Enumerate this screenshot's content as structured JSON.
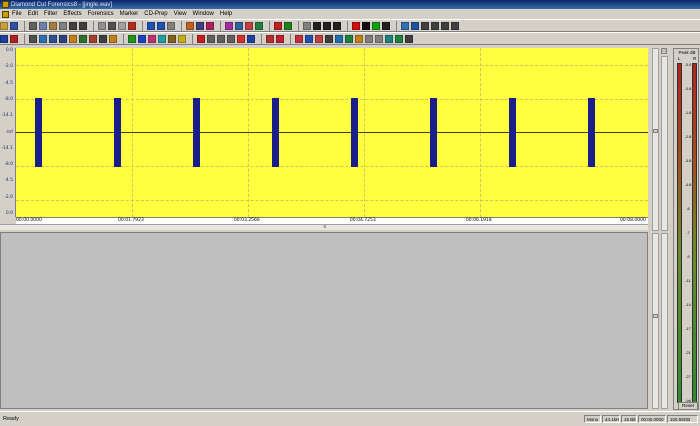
{
  "window": {
    "title": "Diamond Cut Forensics8 - [jingle.wav]"
  },
  "menu": [
    "File",
    "Edit",
    "Filter",
    "Effects",
    "Forensics",
    "Marker",
    "CD-Prep",
    "View",
    "Window",
    "Help"
  ],
  "toolbar_row1": [
    {
      "name": "open-icon",
      "color": "#c8a040"
    },
    {
      "name": "save-icon",
      "color": "#3050a0"
    },
    {
      "name": "sep"
    },
    {
      "name": "cut-icon",
      "color": "#606060"
    },
    {
      "name": "copy-icon",
      "color": "#7080b0"
    },
    {
      "name": "paste-icon",
      "color": "#a08040"
    },
    {
      "name": "print-icon",
      "color": "#808080"
    },
    {
      "name": "undo-icon",
      "color": "#404040"
    },
    {
      "name": "redo-icon",
      "color": "#404040"
    },
    {
      "name": "sep"
    },
    {
      "name": "pencil-icon",
      "color": "#909090"
    },
    {
      "name": "zoom-icon",
      "color": "#505050"
    },
    {
      "name": "select-icon",
      "color": "#a0a0a0"
    },
    {
      "name": "brush-icon",
      "color": "#b03020"
    },
    {
      "name": "sep"
    },
    {
      "name": "tool-a-icon",
      "color": "#2050b0"
    },
    {
      "name": "tool-b-icon",
      "color": "#2050b0"
    },
    {
      "name": "tool-c-icon",
      "color": "#808080"
    },
    {
      "name": "sep"
    },
    {
      "name": "filter-a-icon",
      "color": "#c06020"
    },
    {
      "name": "filter-b-icon",
      "color": "#404080"
    },
    {
      "name": "filter-c-icon",
      "color": "#b02060"
    },
    {
      "name": "sep"
    },
    {
      "name": "spectrum-icon",
      "color": "#a030a0"
    },
    {
      "name": "eq-icon",
      "color": "#3060a0"
    },
    {
      "name": "wave-icon",
      "color": "#c04040"
    },
    {
      "name": "stereo-icon",
      "color": "#208040"
    },
    {
      "name": "sep"
    },
    {
      "name": "globe-icon",
      "color": "#c02020"
    },
    {
      "name": "cd-icon",
      "color": "#208020"
    },
    {
      "name": "sep"
    },
    {
      "name": "skip-start-icon",
      "color": "#808080"
    },
    {
      "name": "rewind-icon",
      "color": "#202020"
    },
    {
      "name": "pause-icon",
      "color": "#202020"
    },
    {
      "name": "skip-end-icon",
      "color": "#202020"
    },
    {
      "name": "sep"
    },
    {
      "name": "record-icon",
      "color": "#d01010"
    },
    {
      "name": "stop-icon",
      "color": "#101010"
    },
    {
      "name": "play-icon",
      "color": "#10a010"
    },
    {
      "name": "loop-icon",
      "color": "#202020"
    },
    {
      "name": "sep"
    },
    {
      "name": "marker-a-icon",
      "color": "#3070b0"
    },
    {
      "name": "marker-b-icon",
      "color": "#2050a0"
    },
    {
      "name": "zoom-in-icon",
      "color": "#404040"
    },
    {
      "name": "zoom-out-icon",
      "color": "#404040"
    },
    {
      "name": "zoom-fit-icon",
      "color": "#404040"
    },
    {
      "name": "zoom-all-icon",
      "color": "#404040"
    }
  ],
  "toolbar_row2": [
    {
      "name": "marker-add-icon",
      "color": "#2040a0"
    },
    {
      "name": "marker-del-icon",
      "color": "#b02020"
    },
    {
      "name": "sep"
    },
    {
      "name": "view-a-icon",
      "color": "#505050"
    },
    {
      "name": "view-b-icon",
      "color": "#3070b0"
    },
    {
      "name": "view-c-icon",
      "color": "#305090"
    },
    {
      "name": "graph-a-icon",
      "color": "#304080"
    },
    {
      "name": "graph-b-icon",
      "color": "#c08020"
    },
    {
      "name": "graph-c-icon",
      "color": "#307030"
    },
    {
      "name": "graph-d-icon",
      "color": "#a04030"
    },
    {
      "name": "cross-icon",
      "color": "#404040"
    },
    {
      "name": "graph-e-icon",
      "color": "#c08020"
    },
    {
      "name": "sep"
    },
    {
      "name": "fx-a-icon",
      "color": "#209020"
    },
    {
      "name": "fx-b-icon",
      "color": "#2040c0"
    },
    {
      "name": "fx-c-icon",
      "color": "#c03070"
    },
    {
      "name": "fx-d-icon",
      "color": "#20a0a0"
    },
    {
      "name": "fx-e-icon",
      "color": "#806020"
    },
    {
      "name": "fx-f-icon",
      "color": "#c0b020"
    },
    {
      "name": "sep"
    },
    {
      "name": "rec-red-icon",
      "color": "#c02020"
    },
    {
      "name": "link-a-icon",
      "color": "#606060"
    },
    {
      "name": "link-b-icon",
      "color": "#606060"
    },
    {
      "name": "link-c-icon",
      "color": "#606060"
    },
    {
      "name": "wave-red-icon",
      "color": "#d03030"
    },
    {
      "name": "eq-blue-icon",
      "color": "#2040a0"
    },
    {
      "name": "sep"
    },
    {
      "name": "bar-red-icon",
      "color": "#b03030"
    },
    {
      "name": "oval-red-icon",
      "color": "#c02030"
    },
    {
      "name": "sep"
    },
    {
      "name": "nav-a-icon",
      "color": "#c03040"
    },
    {
      "name": "nav-b-icon",
      "color": "#2050b0"
    },
    {
      "name": "nav-c-icon",
      "color": "#c04040"
    },
    {
      "name": "nav-d-icon",
      "color": "#404040"
    },
    {
      "name": "nav-e-icon",
      "color": "#2070b0"
    },
    {
      "name": "nav-f-icon",
      "color": "#208040"
    },
    {
      "name": "nav-g-icon",
      "color": "#c08020"
    },
    {
      "name": "nav-h-icon",
      "color": "#808080"
    },
    {
      "name": "nav-i-icon",
      "color": "#808080"
    },
    {
      "name": "nav-j-icon",
      "color": "#208080"
    },
    {
      "name": "nav-k-icon",
      "color": "#208040"
    },
    {
      "name": "nav-l-icon",
      "color": "#404040"
    }
  ],
  "waveform": {
    "background": "#ffff3f",
    "burst_color": "#1a1e8a",
    "db_ticks": [
      "0.0",
      "-2.0",
      "-4.5",
      "-8.0",
      "-14.1",
      "-Inf",
      "-14.1",
      "-8.0",
      "-4.5",
      "-2.0",
      "0.0"
    ],
    "time_labels": [
      "00:00.0000",
      "00:01.7923",
      "00:03.2566",
      "00:04.7253",
      "00:06.1918",
      "00:08.0000"
    ],
    "bursts": [
      0.03,
      0.155,
      0.28,
      0.405,
      0.53,
      0.655,
      0.78,
      0.905
    ]
  },
  "vu_meter": {
    "header": "Peak dB",
    "left_label": "L",
    "right_label": "R",
    "scale": [
      "-0.0",
      "-0.8",
      "-1.8",
      "-2.8",
      "-3.8",
      "-4.8",
      "-6",
      "-7",
      "-9",
      "-11",
      "-14",
      "-17",
      "-21",
      "-27",
      "-Inf"
    ],
    "reset_label": "Reset"
  },
  "status": {
    "ready": "Ready",
    "cells": [
      "Mono",
      "44.1kHz",
      "16 Bits",
      "00:00.0000",
      "100.59GB"
    ]
  }
}
